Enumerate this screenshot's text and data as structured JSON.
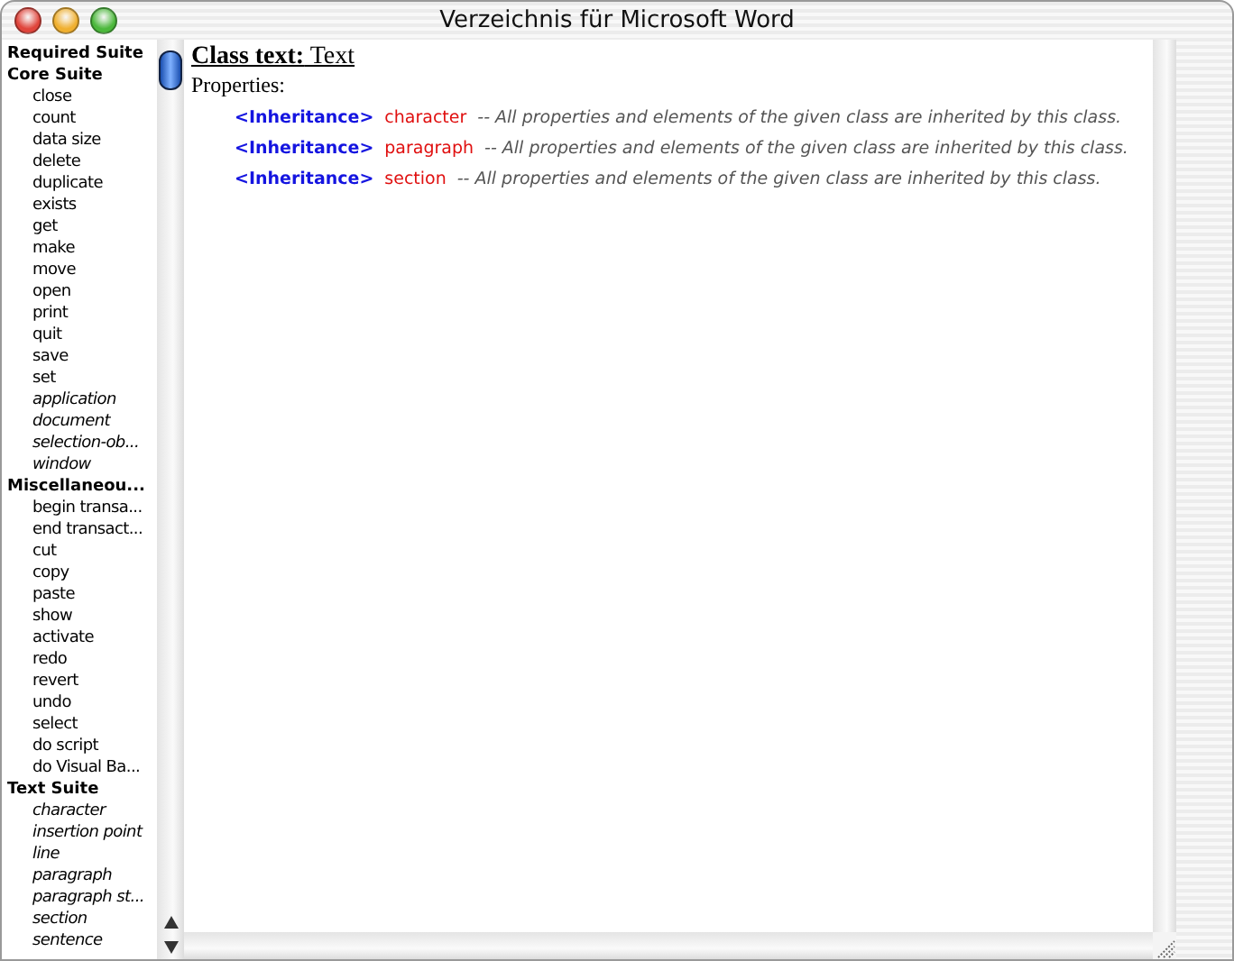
{
  "window": {
    "title": "Verzeichnis für Microsoft Word"
  },
  "sidebar": {
    "items": [
      {
        "kind": "suite",
        "label": "Required Suite"
      },
      {
        "kind": "suite",
        "label": "Core Suite"
      },
      {
        "kind": "command",
        "label": "close"
      },
      {
        "kind": "command",
        "label": "count"
      },
      {
        "kind": "command",
        "label": "data size"
      },
      {
        "kind": "command",
        "label": "delete"
      },
      {
        "kind": "command",
        "label": "duplicate"
      },
      {
        "kind": "command",
        "label": "exists"
      },
      {
        "kind": "command",
        "label": "get"
      },
      {
        "kind": "command",
        "label": "make"
      },
      {
        "kind": "command",
        "label": "move"
      },
      {
        "kind": "command",
        "label": "open"
      },
      {
        "kind": "command",
        "label": "print"
      },
      {
        "kind": "command",
        "label": "quit"
      },
      {
        "kind": "command",
        "label": "save"
      },
      {
        "kind": "command",
        "label": "set"
      },
      {
        "kind": "class",
        "label": "application"
      },
      {
        "kind": "class",
        "label": "document"
      },
      {
        "kind": "class",
        "label": "selection-ob..."
      },
      {
        "kind": "class",
        "label": "window"
      },
      {
        "kind": "suite",
        "label": "Miscellaneou..."
      },
      {
        "kind": "command",
        "label": "begin transa..."
      },
      {
        "kind": "command",
        "label": "end transact..."
      },
      {
        "kind": "command",
        "label": "cut"
      },
      {
        "kind": "command",
        "label": "copy"
      },
      {
        "kind": "command",
        "label": "paste"
      },
      {
        "kind": "command",
        "label": "show"
      },
      {
        "kind": "command",
        "label": "activate"
      },
      {
        "kind": "command",
        "label": "redo"
      },
      {
        "kind": "command",
        "label": "revert"
      },
      {
        "kind": "command",
        "label": "undo"
      },
      {
        "kind": "command",
        "label": "select"
      },
      {
        "kind": "command",
        "label": "do script"
      },
      {
        "kind": "command",
        "label": "do Visual Ba..."
      },
      {
        "kind": "suite",
        "label": "Text Suite"
      },
      {
        "kind": "class",
        "label": "character"
      },
      {
        "kind": "class",
        "label": "insertion point"
      },
      {
        "kind": "class",
        "label": "line"
      },
      {
        "kind": "class",
        "label": "paragraph"
      },
      {
        "kind": "class",
        "label": "paragraph st..."
      },
      {
        "kind": "class",
        "label": "section"
      },
      {
        "kind": "class",
        "label": "sentence"
      }
    ]
  },
  "content": {
    "heading": "**Class text:** Text",
    "section_label": "Properties:",
    "properties": [
      {
        "tag": "<Inheritance>",
        "name": "character",
        "description": "-- All properties and elements of the given class are inherited by this class."
      },
      {
        "tag": "<Inheritance>",
        "name": "paragraph",
        "description": "-- All properties and elements of the given class are inherited by this class."
      },
      {
        "tag": "<Inheritance>",
        "name": "section",
        "description": "-- All properties and elements of the given class are inherited by this class."
      }
    ]
  }
}
